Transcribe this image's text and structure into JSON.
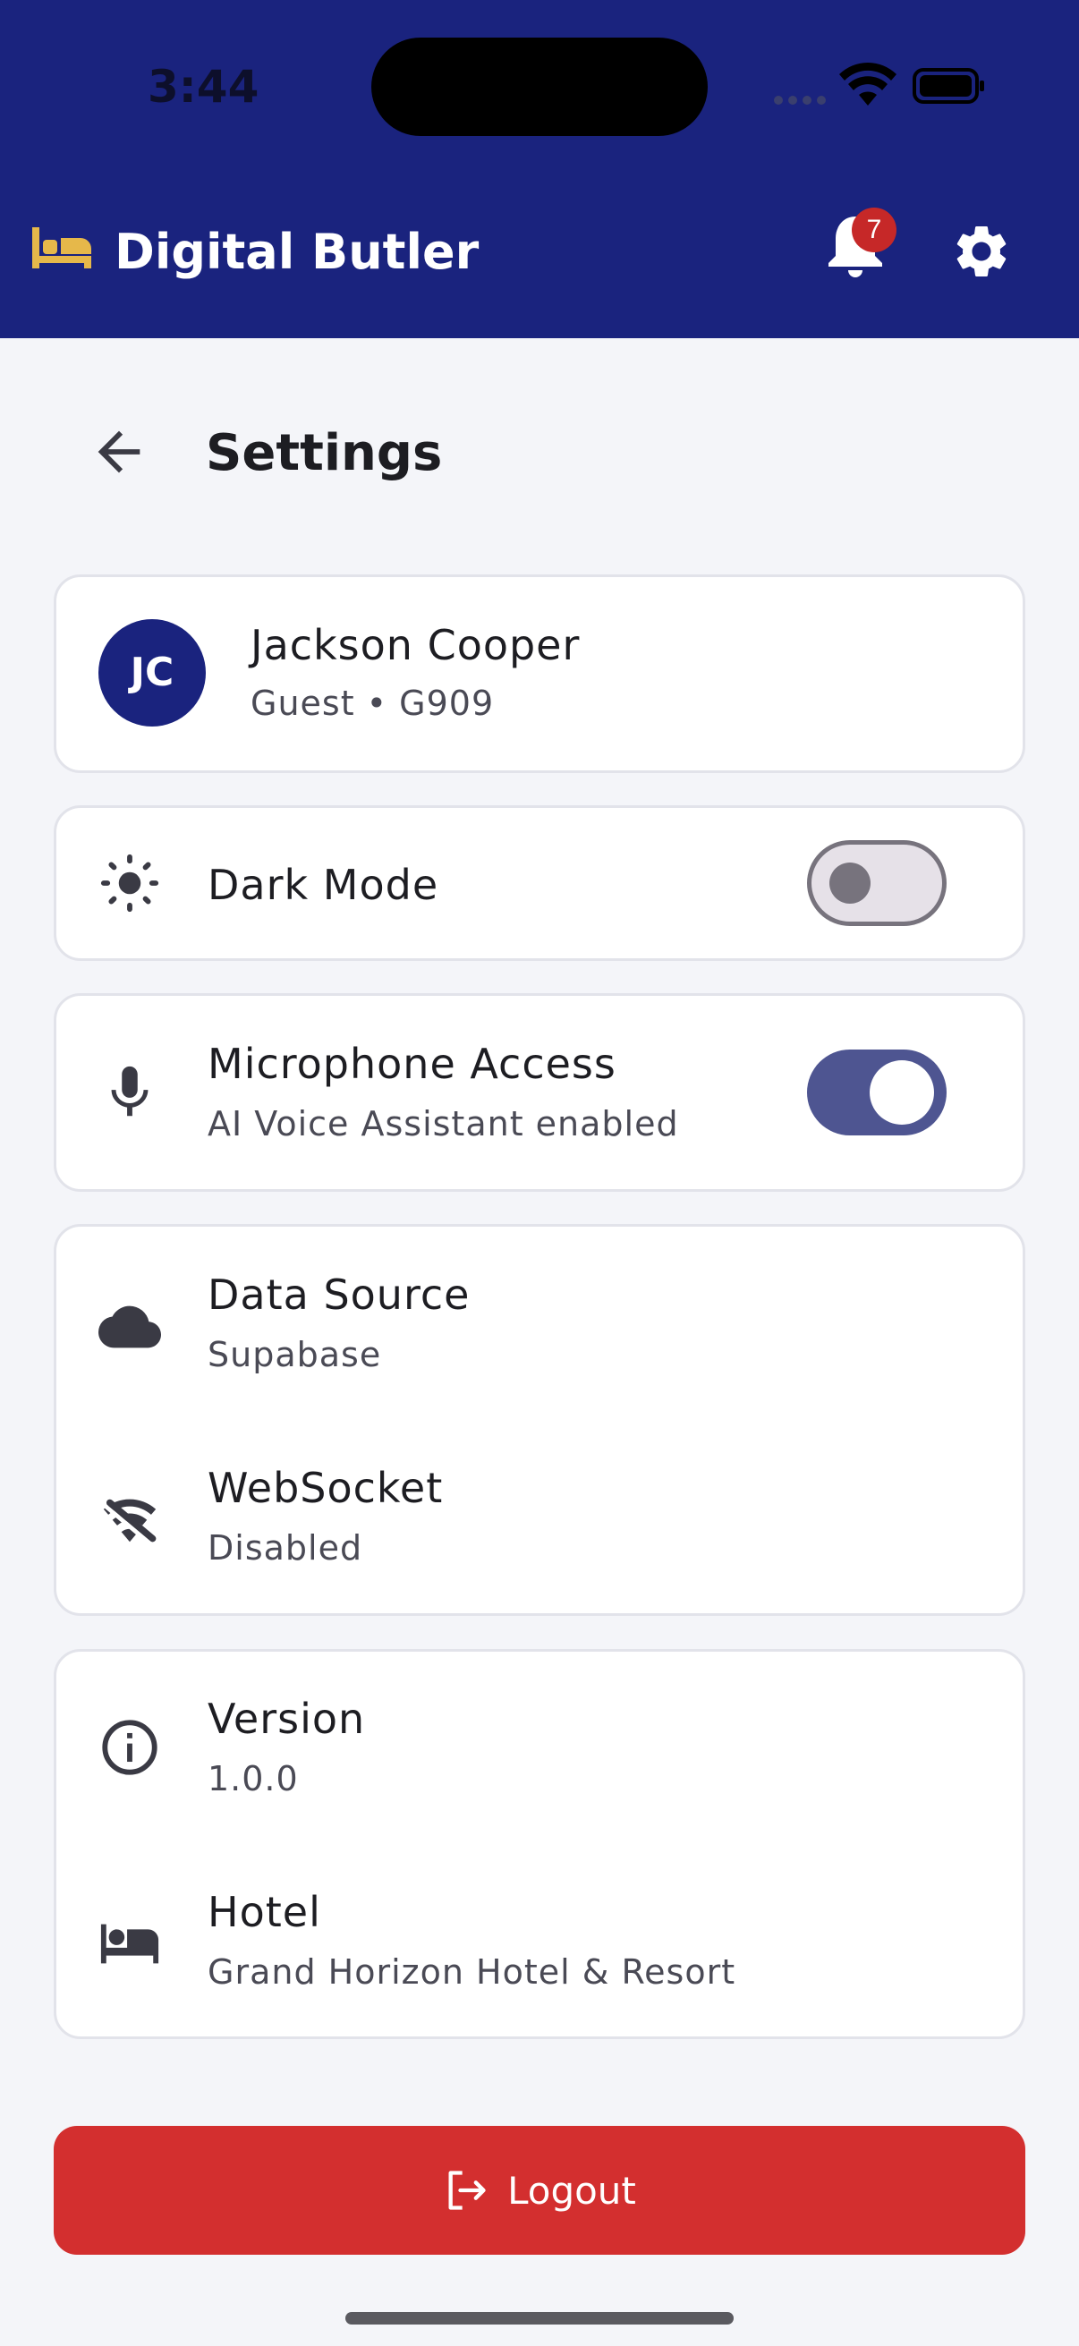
{
  "status_bar": {
    "time": "3:44"
  },
  "header": {
    "app_title": "Digital Butler",
    "notification_count": "7",
    "brand_icon": "bed-icon",
    "colors": {
      "header_bg": "#1a237e",
      "brand_icon": "#e6b84a",
      "badge": "#c62828"
    }
  },
  "page": {
    "title": "Settings"
  },
  "profile": {
    "initials": "JC",
    "name": "Jackson Cooper",
    "subtitle": "Guest • G909"
  },
  "settings": {
    "dark_mode": {
      "label": "Dark Mode",
      "enabled": false
    },
    "microphone": {
      "label": "Microphone Access",
      "subtitle": "AI Voice Assistant enabled",
      "enabled": true
    },
    "data_source": {
      "label": "Data Source",
      "value": "Supabase"
    },
    "websocket": {
      "label": "WebSocket",
      "value": "Disabled"
    },
    "version": {
      "label": "Version",
      "value": "1.0.0"
    },
    "hotel": {
      "label": "Hotel",
      "value": "Grand Horizon Hotel & Resort"
    }
  },
  "logout": {
    "label": "Logout",
    "color": "#d32f2f"
  }
}
